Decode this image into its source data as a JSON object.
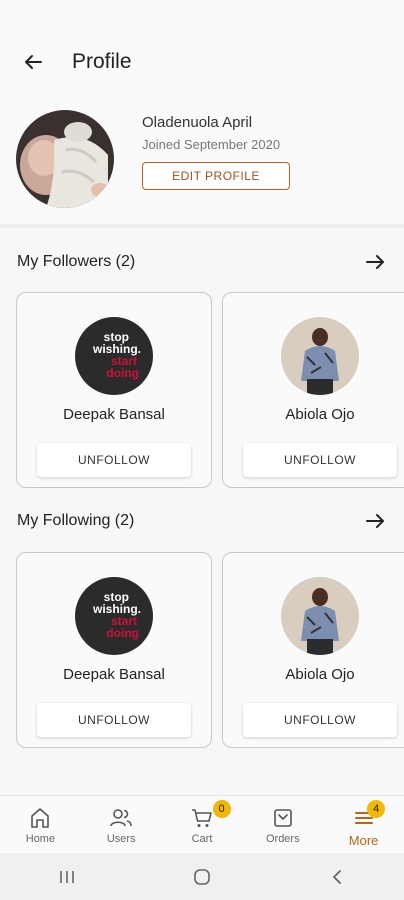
{
  "header": {
    "title": "Profile"
  },
  "profile": {
    "name": "Oladenuola April",
    "joined": "Joined September 2020",
    "edit_label": "EDIT PROFILE"
  },
  "followers": {
    "title": "My Followers (2)",
    "users": [
      {
        "name": "Deepak Bansal",
        "button": "UNFOLLOW",
        "avatar_text": [
          "stop",
          "wishing.",
          "start",
          "doing"
        ]
      },
      {
        "name": "Abiola Ojo",
        "button": "UNFOLLOW"
      }
    ]
  },
  "following": {
    "title": "My Following (2)",
    "users": [
      {
        "name": "Deepak Bansal",
        "button": "UNFOLLOW",
        "avatar_text": [
          "stop",
          "wishing.",
          "start",
          "doing"
        ]
      },
      {
        "name": "Abiola Ojo",
        "button": "UNFOLLOW"
      }
    ]
  },
  "nav": {
    "items": [
      {
        "label": "Home",
        "icon": "home-icon"
      },
      {
        "label": "Users",
        "icon": "users-icon"
      },
      {
        "label": "Cart",
        "icon": "cart-icon",
        "badge": "0"
      },
      {
        "label": "Orders",
        "icon": "orders-icon"
      },
      {
        "label": "More",
        "icon": "menu-icon",
        "badge": "4",
        "active": true
      }
    ]
  },
  "colors": {
    "accent": "#b5651d",
    "badge": "#f2b705"
  }
}
